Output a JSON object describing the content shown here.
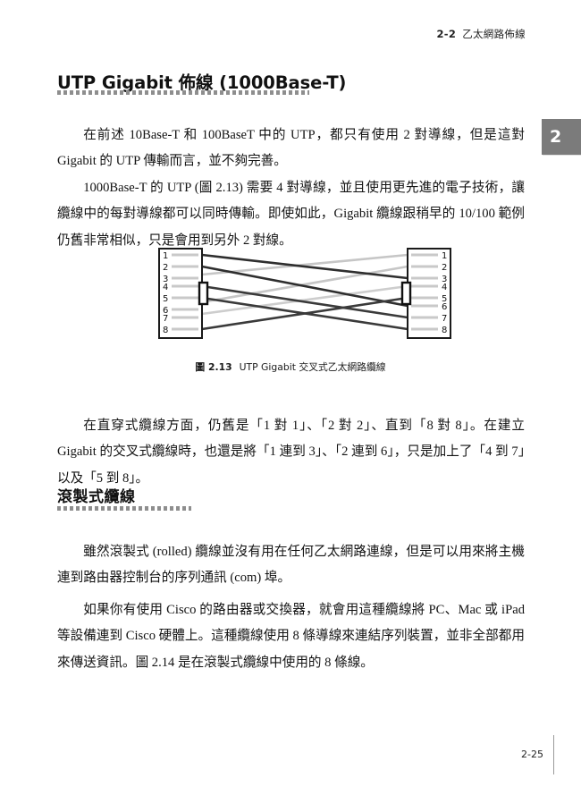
{
  "page": {
    "running_head": {
      "section_number": "2-2",
      "section_title": "乙太網路佈線"
    },
    "chapter_tab": "2",
    "folio": "2-25"
  },
  "sections": [
    {
      "heading": "UTP Gigabit 佈線 (1000Base-T)",
      "paragraphs": [
        "在前述 10Base-T 和 100BaseT 中的 UTP，都只有使用 2 對導線，但是這對 Gigabit 的 UTP 傳輸而言，並不夠完善。",
        "1000Base-T 的 UTP (圖 2.13) 需要 4 對導線，並且使用更先進的電子技術，讓纜線中的每對導線都可以同時傳輸。即使如此，Gigabit 纜線跟稍早的 10/100 範例仍舊非常相似，只是會用到另外 2 對線。",
        "在直穿式纜線方面，仍舊是「1 對 1」、「2 對 2」、直到「8 對 8」。在建立 Gigabit 的交叉式纜線時，也還是將「1 連到 3」、「2 連到 6」，只是加上了「4 到 7」以及「5 到 8」。"
      ]
    },
    {
      "heading": "滾製式纜線",
      "paragraphs": [
        "雖然滾製式 (rolled) 纜線並沒有用在任何乙太網路連線，但是可以用來將主機連到路由器控制台的序列通訊 (com) 埠。",
        "如果你有使用 Cisco 的路由器或交換器，就會用這種纜線將 PC、Mac 或 iPad 等設備連到 Cisco 硬體上。這種纜線使用 8 條導線來連結序列裝置，並非全部都用來傳送資訊。圖 2.14 是在滾製式纜線中使用的 8 條線。"
      ]
    }
  ],
  "figure": {
    "label": "圖 2.13",
    "caption": "UTP Gigabit 交叉式乙太網路纜線",
    "diagram": {
      "type": "wiring",
      "left_connector_pins": [
        "1",
        "2",
        "3",
        "4",
        "5",
        "6",
        "7",
        "8"
      ],
      "right_connector_pins": [
        "1",
        "2",
        "3",
        "4",
        "5",
        "6",
        "7",
        "8"
      ],
      "wires": [
        {
          "from": 1,
          "to": 3,
          "color": "#2e2e2e"
        },
        {
          "from": 2,
          "to": 6,
          "color": "#2e2e2e"
        },
        {
          "from": 3,
          "to": 1,
          "color": "#c2c2c2"
        },
        {
          "from": 4,
          "to": 7,
          "color": "#3a3a3a"
        },
        {
          "from": 5,
          "to": 8,
          "color": "#3a3a3a"
        },
        {
          "from": 6,
          "to": 2,
          "color": "#c2c2c2"
        },
        {
          "from": 7,
          "to": 4,
          "color": "#c8c8c8"
        },
        {
          "from": 8,
          "to": 5,
          "color": "#3a3a3a"
        }
      ],
      "colors": {
        "connector_body": "#ffffff",
        "connector_border": "#1a1a1a",
        "pin_stub": "#c9c9c9",
        "latch": "#111111",
        "wire_dark": "#2e2e2e",
        "wire_light": "#c4c4c4"
      }
    }
  }
}
